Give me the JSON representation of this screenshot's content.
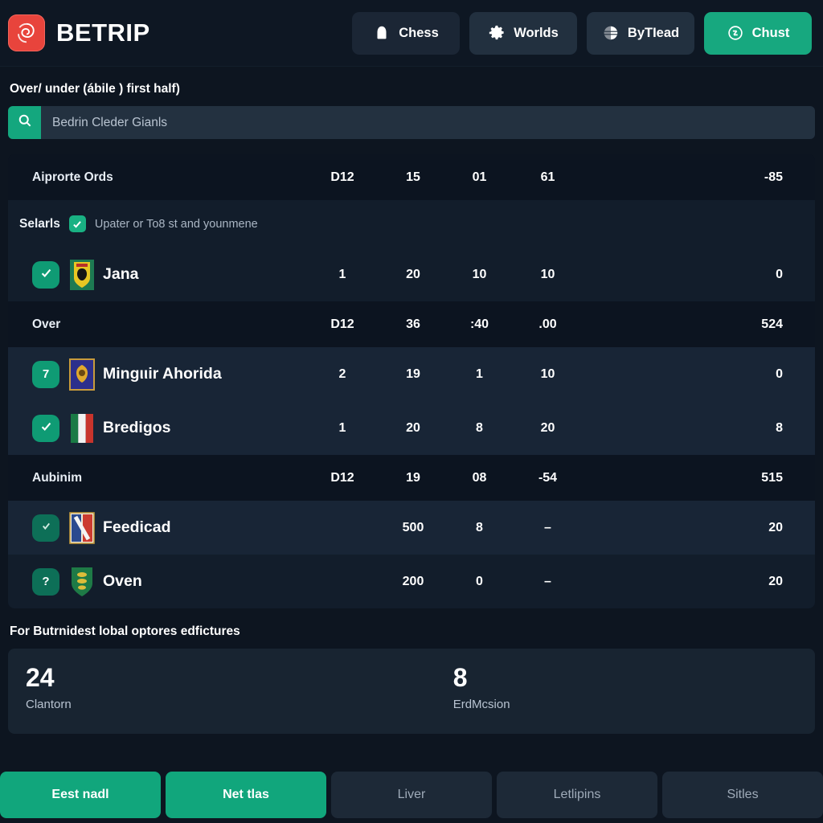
{
  "header": {
    "logo_icon": "rose-spiral-logo-icon",
    "brand": "BETRIP",
    "tabs": [
      {
        "label": "Chess",
        "icon": "shield-icon",
        "state": "inactive"
      },
      {
        "label": "Worlds",
        "icon": "gear-icon",
        "state": "inactive"
      },
      {
        "label": "ByTIead",
        "icon": "globe-icon",
        "state": "inactive"
      },
      {
        "label": "Chust",
        "icon": "refresh-circle-icon",
        "state": "active"
      }
    ]
  },
  "page": {
    "title": "Over/ under (ábile ) first half)",
    "section_label": "For Butrnidest lobal optores edfictures"
  },
  "search": {
    "icon": "search-icon",
    "value": "",
    "placeholder": "Bedrin Cleder Gianls"
  },
  "selection": {
    "label": "Selarls",
    "checkbox_icon": "check-icon",
    "checked": true,
    "note": "Upater or To8 st and younmene"
  },
  "table": {
    "groups": [
      {
        "name": "Aiprorte Ords",
        "values": [
          "D12",
          "15",
          "01",
          "61",
          "-85"
        ],
        "rows": [
          {
            "badge": "check",
            "badge_icon": "check-icon",
            "crest": "crest-green-yellow",
            "name": "Jana",
            "values": [
              "1",
              "20",
              "10",
              "10",
              "0"
            ]
          }
        ]
      },
      {
        "name": "Over",
        "values": [
          "D12",
          "36",
          ":40",
          ".00",
          "524"
        ],
        "rows": [
          {
            "badge": "7",
            "badge_icon": "number-badge",
            "crest": "crest-blue-gold",
            "name": "Mingιιir Ahorida",
            "values": [
              "2",
              "19",
              "1",
              "10",
              "0"
            ]
          },
          {
            "badge": "check",
            "badge_icon": "check-icon",
            "crest": "flag-italy",
            "name": "Bredigos",
            "values": [
              "1",
              "20",
              "8",
              "20",
              "8"
            ]
          }
        ]
      },
      {
        "name": "Aubinim",
        "values": [
          "D12",
          "19",
          "08",
          "-54",
          "515"
        ],
        "rows": [
          {
            "badge": "check-dim",
            "badge_icon": "check-icon",
            "crest": "crest-red-white-blue",
            "name": "Feedicad",
            "values": [
              "",
              "500",
              "8",
              "–",
              "20"
            ]
          },
          {
            "badge": "?",
            "badge_icon": "question-icon",
            "crest": "crest-green-shield",
            "name": "Oven",
            "values": [
              "",
              "200",
              "0",
              "–",
              "20"
            ]
          }
        ]
      }
    ]
  },
  "stats": [
    {
      "number": "24",
      "caption": "Clantorn"
    },
    {
      "number": "8",
      "caption": "ErdMcsion"
    }
  ],
  "bottom_buttons": [
    {
      "label": "Eest nadl",
      "style": "primary"
    },
    {
      "label": "Net tlas",
      "style": "primary"
    },
    {
      "label": "Liver",
      "style": "muted"
    },
    {
      "label": "Letlipins",
      "style": "muted"
    },
    {
      "label": "Sitles",
      "style": "muted"
    }
  ],
  "colors": {
    "accent_green": "#11a67c",
    "logo_red": "#e8443c",
    "page_bg": "#0d1520",
    "row_bg": "#121d2b",
    "row_bg_alt": "#182536"
  }
}
